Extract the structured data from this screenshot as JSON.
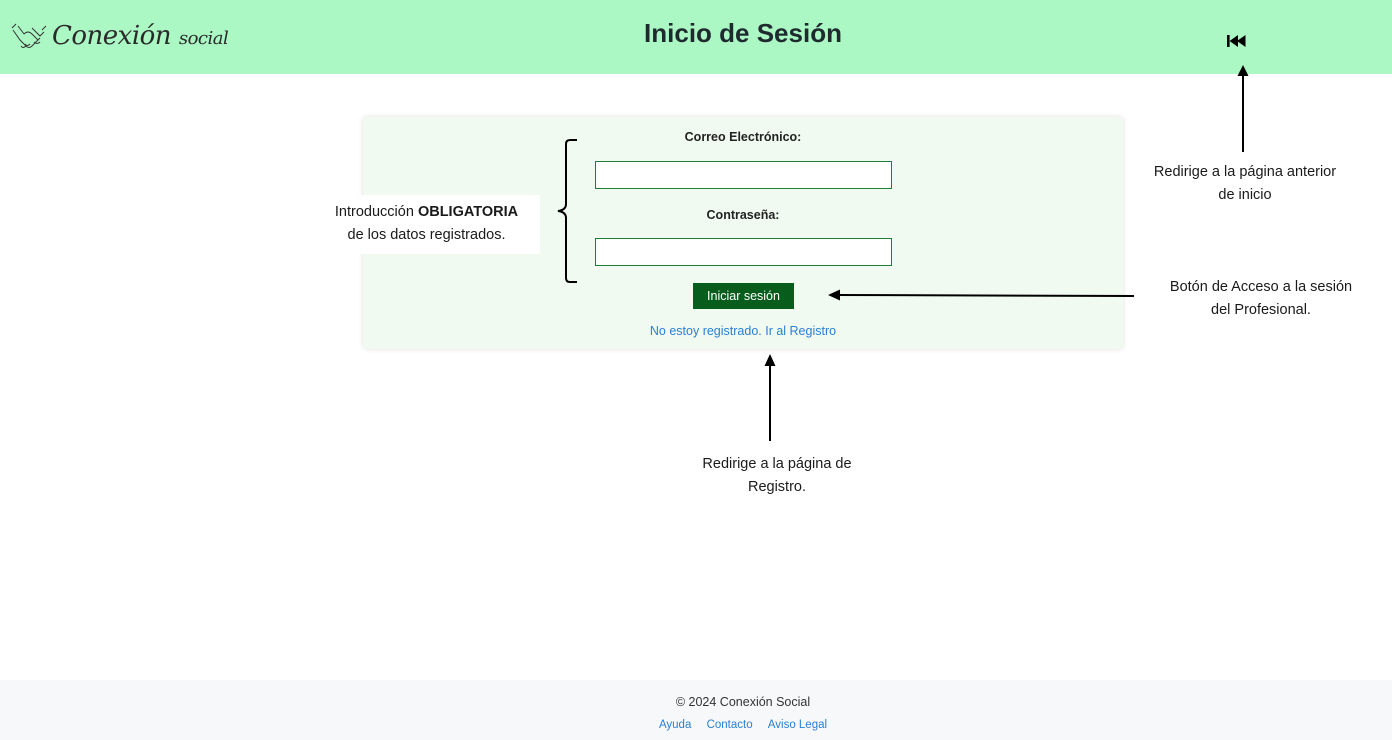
{
  "header": {
    "logo_main": "Conexión",
    "logo_sub": "social",
    "title": "Inicio de Sesión",
    "back_icon": "skip-back-icon"
  },
  "form": {
    "email_label": "Correo Electrónico:",
    "email_value": "",
    "password_label": "Contraseña:",
    "password_value": "",
    "submit_label": "Iniciar sesión",
    "register_link": "No estoy registrado. Ir al Registro"
  },
  "annotations": {
    "required": {
      "prefix": "Introducción ",
      "bold": "OBLIGATORIA",
      "line2": "de los datos registrados."
    },
    "back": {
      "line1": "Redirige a la página anterior",
      "line2": "de inicio"
    },
    "login": {
      "line1": "Botón de Acceso a la sesión",
      "line2": "del Profesional."
    },
    "register": {
      "line1": "Redirige a la página de",
      "line2": "Registro."
    }
  },
  "footer": {
    "copyright": "© 2024 Conexión Social",
    "links": [
      "Ayuda",
      "Contacto",
      "Aviso Legal"
    ]
  },
  "colors": {
    "header_bg": "#abf8c4",
    "card_bg": "#f1faf0",
    "button_bg": "#085d1c",
    "link": "#2a7fd4",
    "input_border": "#1e7d36"
  }
}
